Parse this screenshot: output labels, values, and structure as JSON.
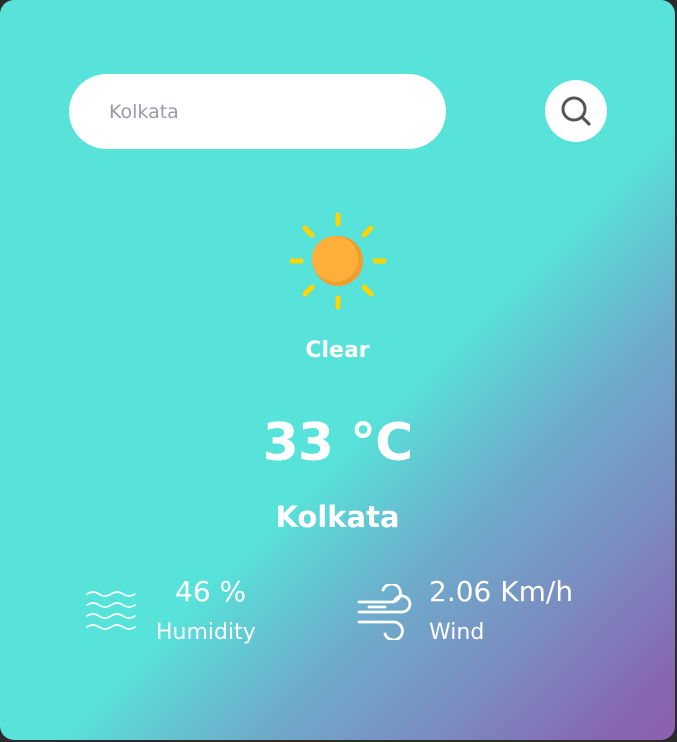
{
  "search": {
    "value": "",
    "placeholder": "Kolkata",
    "button_icon": "search-icon"
  },
  "weather": {
    "icon": "sun-icon",
    "condition": "Clear",
    "temperature": "33 °C",
    "city": "Kolkata"
  },
  "details": {
    "humidity": {
      "icon": "waves-icon",
      "value": "46 %",
      "label": "Humidity"
    },
    "wind": {
      "icon": "wind-icon",
      "value": "2.06 Km/h",
      "label": "Wind"
    }
  },
  "colors": {
    "gradient_start": "#57e2da",
    "gradient_end": "#8b60b0",
    "sun": "#ffad33",
    "sun_rays": "#ffd400"
  }
}
